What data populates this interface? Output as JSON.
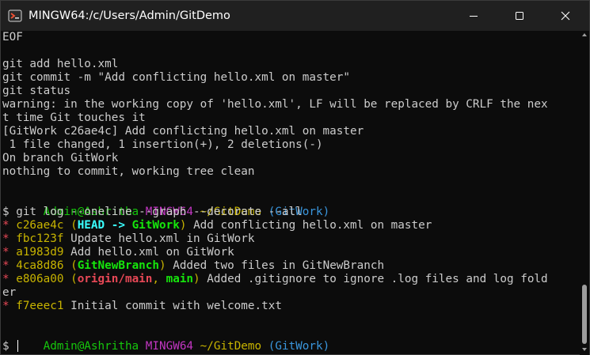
{
  "window": {
    "title": "MINGW64:/c/Users/Admin/GitDemo",
    "controls": {
      "minimize_icon": "minimize-icon",
      "maximize_icon": "maximize-icon",
      "close_icon": "close-icon"
    }
  },
  "colors": {
    "prompt_user": "#16c60c",
    "prompt_system": "#c236c2",
    "prompt_path": "#c8b400",
    "prompt_branch": "#3a96dd",
    "graph_star": "#e74856",
    "commit_hash": "#c8b400",
    "head_ref": "#3affff",
    "local_branch": "#16e60c",
    "remote_branch": "#e74856"
  },
  "terminal": {
    "line1": "EOF",
    "line2": "",
    "line3": "git add hello.xml",
    "line4": "git commit -m \"Add conflicting hello.xml on master\"",
    "line5": "git status",
    "line6": "warning: in the working copy of 'hello.xml', LF will be replaced by CRLF the nex",
    "line7": "t time Git touches it",
    "line8": "[GitWork c26ae4c] Add conflicting hello.xml on master",
    "line9": " 1 file changed, 1 insertion(+), 2 deletions(-)",
    "line10": "On branch GitWork",
    "line11": "nothing to commit, working tree clean",
    "prompt1": {
      "user": "Admin@Ashritha",
      "system": "MINGW64",
      "path": "~/GitDemo",
      "branch": "(GitWork)"
    },
    "command_prefix": "$ ",
    "command": "git log --oneline --graph --decorate --all",
    "log": [
      {
        "star": "*",
        "hash": "c26ae4c",
        "open": "(",
        "head": "HEAD -> ",
        "ref": "GitWork",
        "close": ")",
        "message": "Add conflicting hello.xml on master"
      },
      {
        "star": "*",
        "hash": "fbc123f",
        "message": "Update hello.xml in GitWork"
      },
      {
        "star": "*",
        "hash": "a1983d9",
        "message": "Add hello.xml on GitWork"
      },
      {
        "star": "*",
        "hash": "4ca8d86",
        "open": "(",
        "ref": "GitNewBranch",
        "close": ")",
        "message": "Added two files in GitNewBranch"
      },
      {
        "star": "*",
        "hash": "e806a00",
        "open": "(",
        "remote": "origin/main",
        "sep": ", ",
        "ref": "main",
        "close": ")",
        "message": "Added .gitignore to ignore .log files and log fold",
        "wrap": "er"
      },
      {
        "star": "*",
        "hash": "f7eeec1",
        "message": "Initial commit with welcome.txt"
      }
    ],
    "prompt2": {
      "user": "Admin@Ashritha",
      "system": "MINGW64",
      "path": "~/GitDemo",
      "branch": "(GitWork)"
    },
    "final_prompt": "$"
  }
}
